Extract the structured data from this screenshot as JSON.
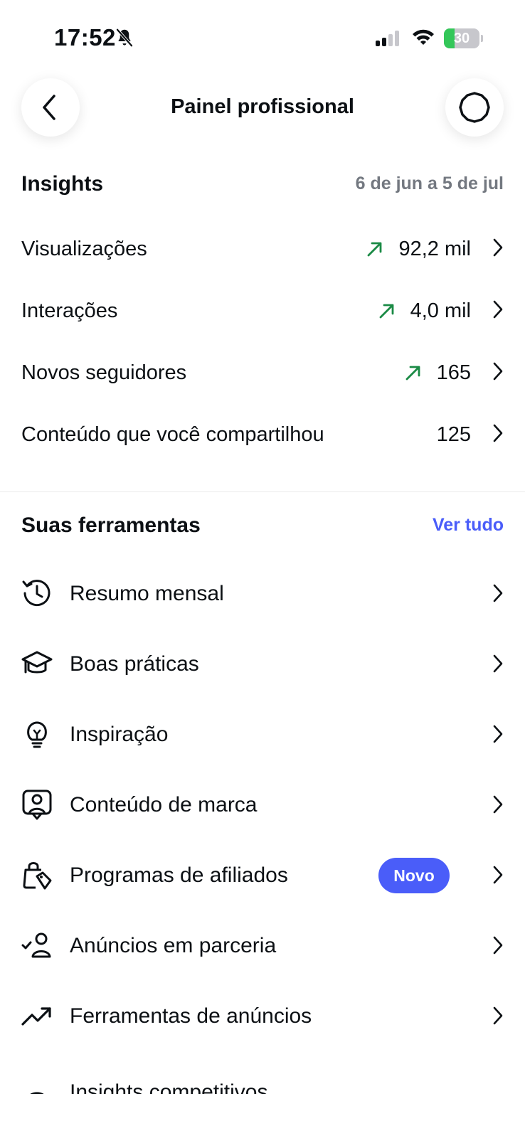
{
  "status_bar": {
    "time": "17:52",
    "battery": "30",
    "battery_level": 0.3,
    "icons": [
      "bell-slash-icon",
      "cellular-signal-icon",
      "wifi-icon",
      "battery-charging-icon"
    ]
  },
  "header": {
    "title": "Painel profissional",
    "back_icon": "chevron-left-icon",
    "settings_icon": "gear-icon"
  },
  "insights": {
    "title": "Insights",
    "date_range": "6 de jun a 5 de jul",
    "metrics": [
      {
        "label": "Visualizações",
        "value": "92,2 mil",
        "trend": "up"
      },
      {
        "label": "Interações",
        "value": "4,0 mil",
        "trend": "up"
      },
      {
        "label": "Novos seguidores",
        "value": "165",
        "trend": "up"
      },
      {
        "label": "Conteúdo que você compartilhou",
        "value": "125",
        "trend": "none"
      }
    ]
  },
  "tools": {
    "title": "Suas ferramentas",
    "see_all": "Ver tudo",
    "items": [
      {
        "label": "Resumo mensal",
        "icon": "history-clock-icon"
      },
      {
        "label": "Boas práticas",
        "icon": "graduation-cap-icon"
      },
      {
        "label": "Inspiração",
        "icon": "lightbulb-icon"
      },
      {
        "label": "Conteúdo de marca",
        "icon": "branded-content-icon"
      },
      {
        "label": "Programas de afiliados",
        "icon": "shopping-bag-tag-icon",
        "badge": "Novo"
      },
      {
        "label": "Anúncios em parceria",
        "icon": "person-check-icon"
      },
      {
        "label": "Ferramentas de anúncios",
        "icon": "trending-up-icon"
      },
      {
        "label": "Insights competitivos",
        "icon": "gauge-icon"
      }
    ]
  },
  "colors": {
    "accent": "#4a5df9",
    "trend_up": "#1a8a45",
    "secondary_text": "#737880",
    "battery_green": "#34c759"
  }
}
